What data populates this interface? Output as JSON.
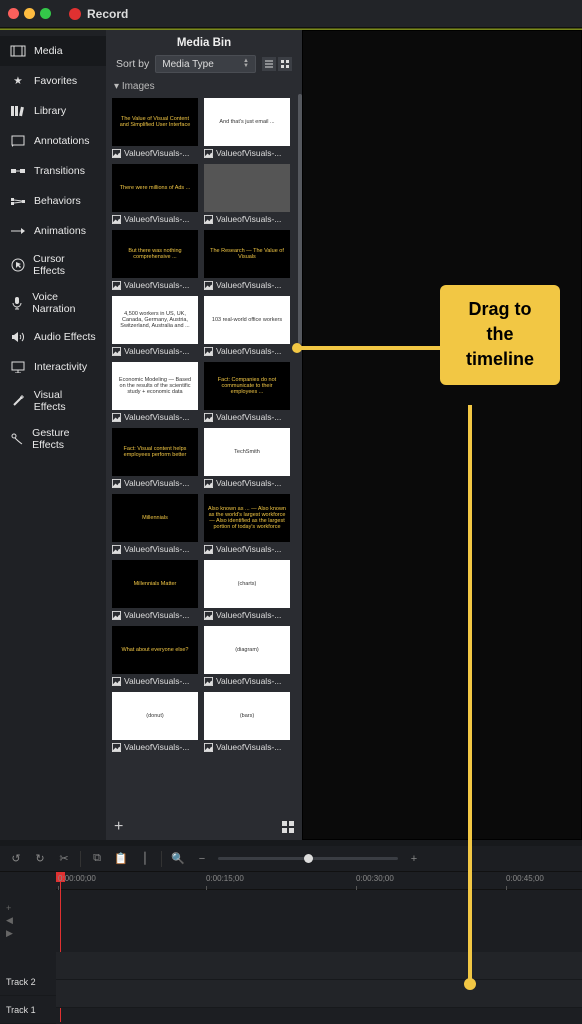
{
  "titlebar": {
    "label": "Record"
  },
  "sidebar": {
    "items": [
      {
        "label": "Media",
        "icon": "film-icon"
      },
      {
        "label": "Favorites",
        "icon": "star-icon"
      },
      {
        "label": "Library",
        "icon": "books-icon"
      },
      {
        "label": "Annotations",
        "icon": "note-icon"
      },
      {
        "label": "Transitions",
        "icon": "transitions-icon"
      },
      {
        "label": "Behaviors",
        "icon": "behaviors-icon"
      },
      {
        "label": "Animations",
        "icon": "animations-icon"
      },
      {
        "label": "Cursor Effects",
        "icon": "cursor-icon"
      },
      {
        "label": "Voice Narration",
        "icon": "mic-icon"
      },
      {
        "label": "Audio Effects",
        "icon": "speaker-icon"
      },
      {
        "label": "Interactivity",
        "icon": "interactivity-icon"
      },
      {
        "label": "Visual Effects",
        "icon": "wand-icon"
      },
      {
        "label": "Gesture Effects",
        "icon": "gesture-icon"
      }
    ]
  },
  "panel": {
    "title": "Media Bin",
    "sort_label": "Sort by",
    "sort_value": "Media Type",
    "group": "Images",
    "caption": "ValueofVisuals-..."
  },
  "thumbs": [
    [
      {
        "kind": "dark",
        "t": "The Value of Visual Content and Simplified User Interface"
      },
      {
        "kind": "light",
        "t": "And that's just email ..."
      }
    ],
    [
      {
        "kind": "dark",
        "t": "There were millions of Ads ..."
      },
      {
        "kind": "img",
        "t": ""
      }
    ],
    [
      {
        "kind": "dark",
        "t": "But there was nothing comprehensive ..."
      },
      {
        "kind": "dark",
        "t": "The Research — The Value of Visuals"
      }
    ],
    [
      {
        "kind": "light",
        "t": "4,500 workers in US, UK, Canada, Germany, Austria, Switzerland, Australia and ..."
      },
      {
        "kind": "light",
        "t": "103 real-world office workers"
      }
    ],
    [
      {
        "kind": "light",
        "t": "Economic Modeling — Based on the results of the scientific study + economic data"
      },
      {
        "kind": "dark",
        "t": "Fact: Companies do not communicate to their employees ..."
      }
    ],
    [
      {
        "kind": "dark",
        "t": "Fact: Visual content helps employees perform better"
      },
      {
        "kind": "light",
        "t": "TechSmith"
      }
    ],
    [
      {
        "kind": "dark",
        "t": "Millennials"
      },
      {
        "kind": "dark",
        "t": "Also known as ... — Also known as the world's largest workforce — Also identified as the largest portion of today's workforce"
      }
    ],
    [
      {
        "kind": "dark",
        "t": "Millennials Matter"
      },
      {
        "kind": "light",
        "t": "(charts)"
      }
    ],
    [
      {
        "kind": "dark",
        "t": "What about everyone else?"
      },
      {
        "kind": "light",
        "t": "(diagram)"
      }
    ],
    [
      {
        "kind": "light",
        "t": "(donut)"
      },
      {
        "kind": "light",
        "t": "(bars)"
      }
    ]
  ],
  "timeline": {
    "marks": [
      "0:00:00;00",
      "0:00:15;00",
      "0:00:30;00",
      "0:00:45;00"
    ],
    "tracks": [
      "Track 2",
      "Track 1"
    ]
  },
  "callout": {
    "line1": "Drag to",
    "line2": "the",
    "line3": "timeline"
  }
}
